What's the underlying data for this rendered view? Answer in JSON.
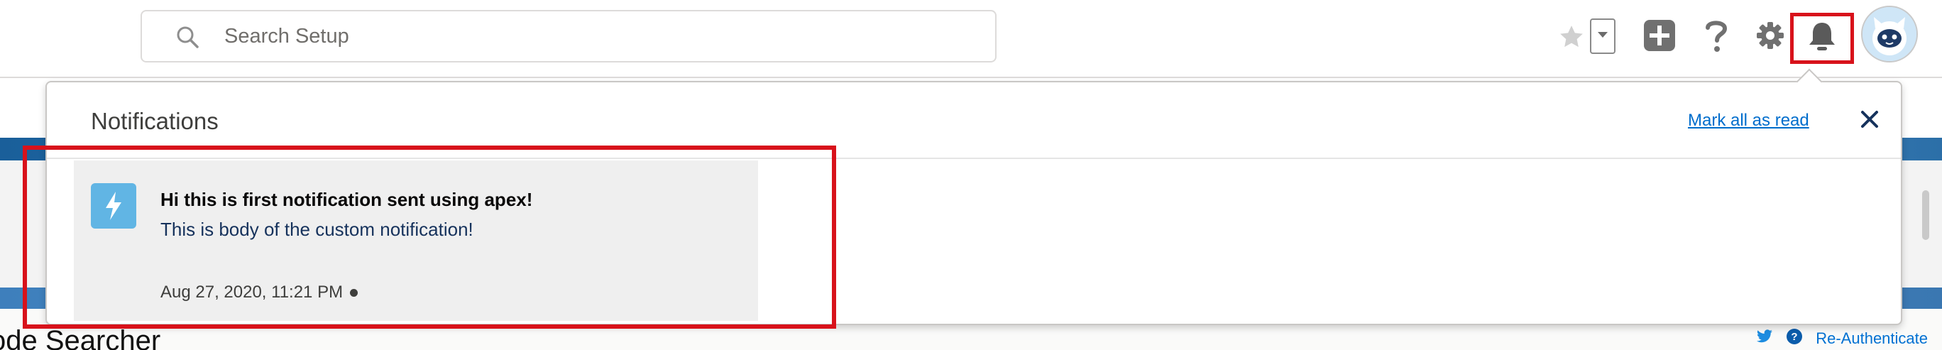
{
  "header": {
    "search": {
      "placeholder": "Search Setup"
    },
    "icons": {
      "favorites": "star-icon",
      "favorites_menu": "chevron-down-icon",
      "global_actions": "plus-icon",
      "help": "question-icon",
      "setup": "gear-icon",
      "notifications": "bell-icon",
      "avatar": "astro-avatar"
    }
  },
  "notifications": {
    "title": "Notifications",
    "mark_all_label": "Mark all as read",
    "close_icon": "close-icon",
    "items": [
      {
        "title": "Hi this is first notification sent using apex!",
        "body": "This is body of the custom notification!",
        "timestamp": "Aug 27, 2020, 11:21 PM",
        "unread": true,
        "icon": "lightning-bolt-icon"
      }
    ]
  },
  "background_page": {
    "title": "ode Searcher",
    "reauth_label": "Re-Authenticate"
  },
  "colors": {
    "accent": "#d8121b",
    "link": "#0070d2",
    "notification_icon_bg": "#61b5e4"
  }
}
